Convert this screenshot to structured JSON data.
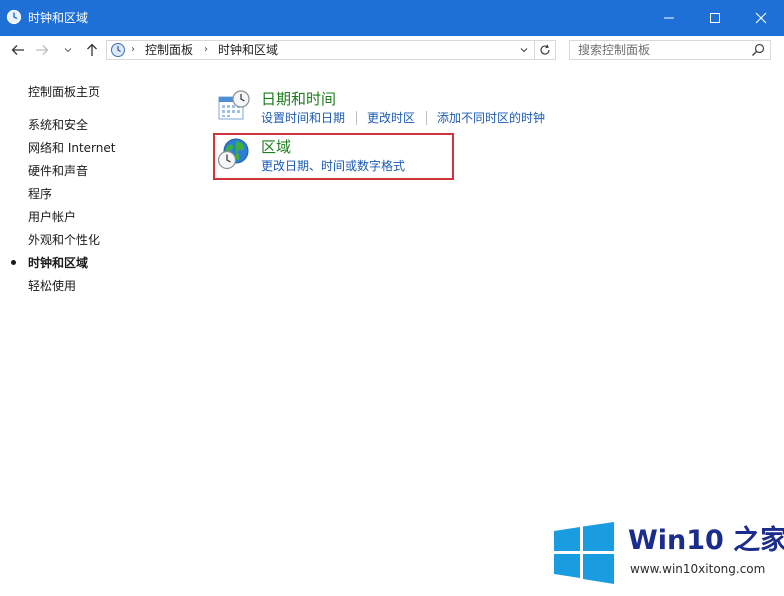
{
  "window": {
    "title": "时钟和区域",
    "minimize_icon": "minimize-icon",
    "maximize_icon": "maximize-icon",
    "close_icon": "close-icon"
  },
  "address_bar": {
    "breadcrumbs": [
      "控制面板",
      "时钟和区域"
    ],
    "search_placeholder": "搜索控制面板"
  },
  "sidebar": {
    "items": [
      {
        "label": "控制面板主页"
      },
      {
        "label": "系统和安全"
      },
      {
        "label": "网络和 Internet"
      },
      {
        "label": "硬件和声音"
      },
      {
        "label": "程序"
      },
      {
        "label": "用户帐户"
      },
      {
        "label": "外观和个性化"
      },
      {
        "label": "时钟和区域",
        "current": true
      },
      {
        "label": "轻松使用"
      }
    ]
  },
  "categories": [
    {
      "title": "日期和时间",
      "icon": "calendar-clock-icon",
      "links": [
        "设置时间和日期",
        "更改时区",
        "添加不同时区的时钟"
      ]
    },
    {
      "title": "区域",
      "icon": "globe-clock-icon",
      "links": [
        "更改日期、时间或数字格式"
      ]
    }
  ],
  "watermark": {
    "brand": "Win10 之家",
    "url": "www.win10xitong.com"
  },
  "colors": {
    "titlebar": "#1e6fd6",
    "category_title": "#1e7b1e",
    "link": "#1c5bb3",
    "highlight": "#d0343a",
    "windows_logo": "#1a9ce0"
  }
}
